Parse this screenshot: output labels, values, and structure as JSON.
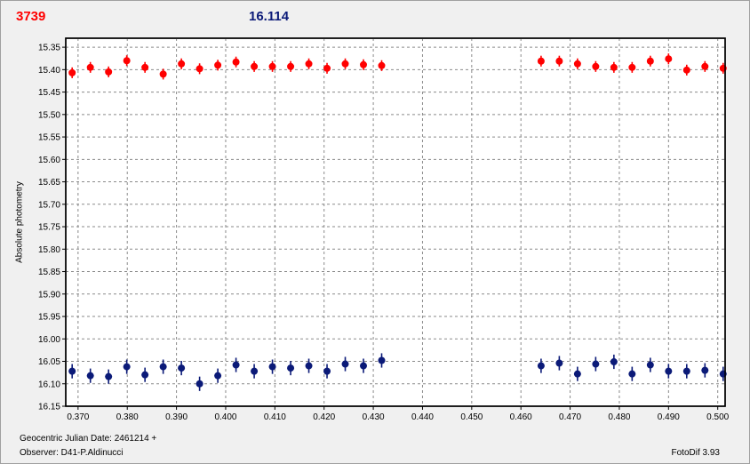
{
  "header": {
    "red_value": "3739",
    "blue_value": "16.114"
  },
  "footer": {
    "date_label": "Geocentric Julian Date: 2461214 +",
    "observer_label": "Observer: D41-P.Aldinucci",
    "software_label": "FotoDif 3.93"
  },
  "colors": {
    "red_series": "#ff0000",
    "blue_series": "#0b1a78",
    "background": "#f0f0f0",
    "grid": "#8a8a8a"
  },
  "chart_data": {
    "type": "scatter",
    "title": "",
    "xlabel": "",
    "ylabel": "Absolute photometry",
    "xlim": [
      0.3675,
      0.5015
    ],
    "ylim": [
      15.33,
      16.15
    ],
    "y_inverted": true,
    "grid": true,
    "x_ticks": [
      "0.370",
      "0.380",
      "0.390",
      "0.400",
      "0.410",
      "0.420",
      "0.430",
      "0.440",
      "0.450",
      "0.460",
      "0.470",
      "0.480",
      "0.490",
      "0.500"
    ],
    "y_ticks": [
      "15.35",
      "15.40",
      "15.45",
      "15.50",
      "15.55",
      "15.60",
      "15.65",
      "15.70",
      "15.75",
      "15.80",
      "15.85",
      "15.90",
      "15.95",
      "16.00",
      "16.05",
      "16.10",
      "16.15"
    ],
    "series": [
      {
        "color": "#ff0000",
        "x": [
          0.3688,
          0.3725,
          0.3762,
          0.3799,
          0.3836,
          0.3873,
          0.391,
          0.3947,
          0.3984,
          0.4021,
          0.4058,
          0.4095,
          0.4132,
          0.4169,
          0.4206,
          0.4243,
          0.428,
          0.4317,
          0.4641,
          0.4678,
          0.4715,
          0.4752,
          0.4789,
          0.4826,
          0.4863,
          0.49,
          0.4937,
          0.4974,
          0.5011
        ],
        "y": [
          15.407,
          15.395,
          15.405,
          15.38,
          15.395,
          15.41,
          15.387,
          15.398,
          15.39,
          15.383,
          15.393,
          15.393,
          15.393,
          15.387,
          15.397,
          15.387,
          15.389,
          15.391,
          15.381,
          15.381,
          15.387,
          15.393,
          15.395,
          15.395,
          15.381,
          15.376,
          15.401,
          15.393,
          15.397
        ],
        "error": [
          0.012,
          0.012,
          0.012,
          0.012,
          0.012,
          0.012,
          0.012,
          0.012,
          0.012,
          0.012,
          0.012,
          0.012,
          0.012,
          0.012,
          0.012,
          0.012,
          0.012,
          0.012,
          0.012,
          0.012,
          0.012,
          0.012,
          0.012,
          0.012,
          0.012,
          0.012,
          0.012,
          0.012,
          0.012
        ]
      },
      {
        "color": "#0b1a78",
        "x": [
          0.3688,
          0.3725,
          0.3762,
          0.3799,
          0.3836,
          0.3873,
          0.391,
          0.3947,
          0.3984,
          0.4021,
          0.4058,
          0.4095,
          0.4132,
          0.4169,
          0.4206,
          0.4243,
          0.428,
          0.4317,
          0.4641,
          0.4678,
          0.4715,
          0.4752,
          0.4789,
          0.4826,
          0.4863,
          0.49,
          0.4937,
          0.4974,
          0.5011
        ],
        "y": [
          16.072,
          16.082,
          16.084,
          16.062,
          16.08,
          16.062,
          16.065,
          16.1,
          16.082,
          16.058,
          16.072,
          16.062,
          16.065,
          16.06,
          16.072,
          16.056,
          16.06,
          16.048,
          16.06,
          16.054,
          16.078,
          16.056,
          16.051,
          16.078,
          16.058,
          16.072,
          16.072,
          16.07,
          16.078
        ],
        "error": [
          0.016,
          0.016,
          0.016,
          0.016,
          0.016,
          0.016,
          0.016,
          0.016,
          0.016,
          0.016,
          0.016,
          0.016,
          0.016,
          0.016,
          0.016,
          0.016,
          0.016,
          0.016,
          0.016,
          0.016,
          0.016,
          0.016,
          0.016,
          0.016,
          0.016,
          0.016,
          0.016,
          0.016,
          0.016
        ]
      }
    ]
  }
}
